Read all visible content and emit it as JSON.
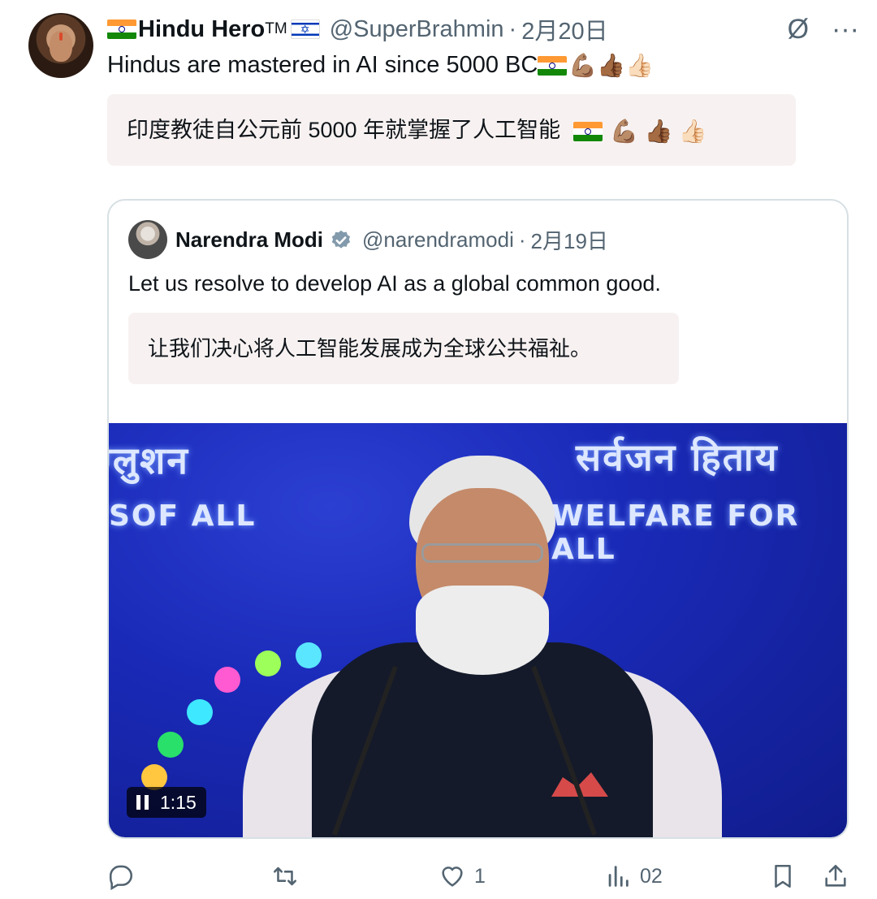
{
  "tweet": {
    "display_name": "Hindu Hero",
    "tm": "TM",
    "handle": "@SuperBrahmin",
    "separator": "·",
    "date": "2月20日",
    "text": "Hindus are mastered in AI since 5000 BC",
    "translation": "印度教徒自公元前 5000 年就掌握了人工智能",
    "emojis": [
      "💪🏽",
      "👍🏾",
      "👍🏻"
    ]
  },
  "top_icons": {
    "grok_icon": "Ø",
    "more_icon": "···"
  },
  "quote": {
    "display_name": "Narendra Modi",
    "handle": "@narendramodi",
    "separator": "·",
    "date": "2月19日",
    "text": "Let us resolve to develop AI as a global common good.",
    "translation": "让我们决心将人工智能发展成为全球公共福祉。",
    "video": {
      "time": "1:15",
      "banner_left_top": "ग्लुशन",
      "banner_left_bottom": "SOF ALL",
      "banner_right_top": "सर्वजन हिताय",
      "banner_right_bottom": "WELFARE FOR ALL"
    }
  },
  "actions": {
    "reply_count": "",
    "retweet_count": "",
    "like_count": "1",
    "views_count": "02"
  },
  "colors": {
    "accent": "#1d9bf0",
    "muted": "#536471",
    "translation_bg": "#f7f2f1",
    "verified": "#829aab"
  }
}
